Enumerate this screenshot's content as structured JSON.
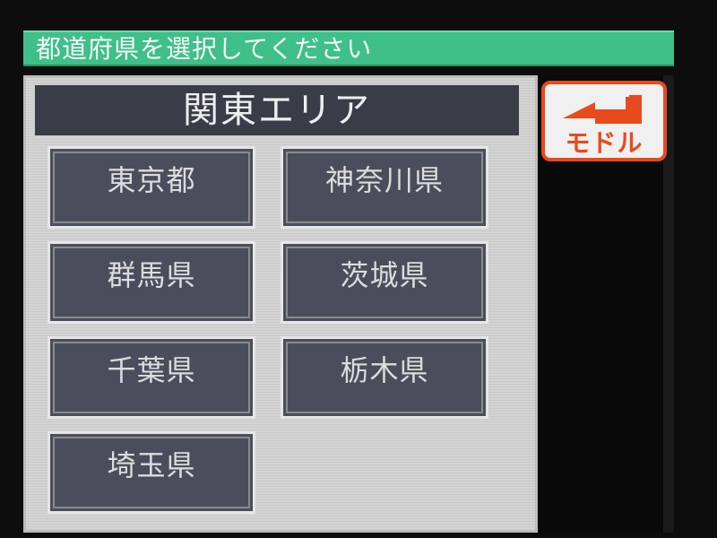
{
  "instruction": "都道府県を選択してください",
  "area_title": "関東エリア",
  "prefectures": [
    {
      "label": "東京都"
    },
    {
      "label": "神奈川県"
    },
    {
      "label": "群馬県"
    },
    {
      "label": "茨城県"
    },
    {
      "label": "千葉県"
    },
    {
      "label": "栃木県"
    },
    {
      "label": "埼玉県"
    }
  ],
  "back_button": {
    "label": "モドル",
    "icon": "return-arrow-icon",
    "color": "#e84a1e"
  },
  "colors": {
    "instruction_bar": "#3fbf8a",
    "header": "#3a3c48",
    "button": "#4a4e5c",
    "panel": "#d4d4d4"
  }
}
